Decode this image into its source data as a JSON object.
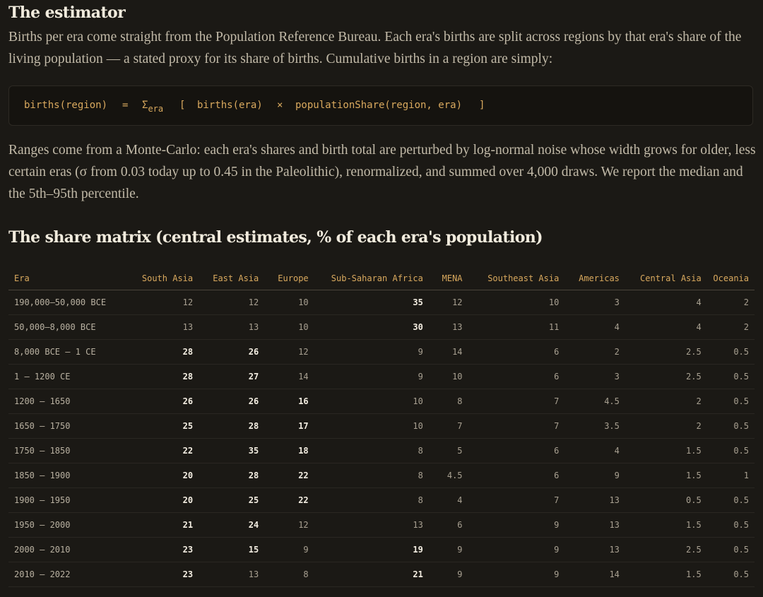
{
  "estimator": {
    "heading": "The estimator",
    "intro": "Births per era come straight from the Population Reference Bureau. Each era's births are split across regions by that era's share of the living population — a stated proxy for its share of births. Cumulative births in a region are simply:",
    "formula": {
      "lhs": "births(region)",
      "eq": "=",
      "sigma": "Σ",
      "sigma_sub": "era",
      "open": "[",
      "term1": "births(era)",
      "times": "×",
      "term2": "populationShare(region, era)",
      "close": "]"
    },
    "ranges": "Ranges come from a Monte-Carlo: each era's shares and birth total are perturbed by log-normal noise whose width grows for older, less certain eras (σ from 0.03 today up to 0.45 in the Paleolithic), renormalized, and summed over 4,000 draws. We report the median and the 5th–95th percentile."
  },
  "share_matrix": {
    "heading": "The share matrix (central estimates, % of each era's population)",
    "columns": [
      "Era",
      "South Asia",
      "East Asia",
      "Europe",
      "Sub-Saharan Africa",
      "MENA",
      "Southeast Asia",
      "Americas",
      "Central Asia",
      "Oceania"
    ],
    "rows": [
      {
        "era": "190,000–50,000 BCE",
        "values": [
          "12",
          "12",
          "10",
          "35",
          "12",
          "10",
          "3",
          "4",
          "2"
        ],
        "highlight": [
          false,
          false,
          false,
          true,
          false,
          false,
          false,
          false,
          false
        ]
      },
      {
        "era": "50,000–8,000 BCE",
        "values": [
          "13",
          "13",
          "10",
          "30",
          "13",
          "11",
          "4",
          "4",
          "2"
        ],
        "highlight": [
          false,
          false,
          false,
          true,
          false,
          false,
          false,
          false,
          false
        ]
      },
      {
        "era": "8,000 BCE – 1 CE",
        "values": [
          "28",
          "26",
          "12",
          "9",
          "14",
          "6",
          "2",
          "2.5",
          "0.5"
        ],
        "highlight": [
          true,
          true,
          false,
          false,
          false,
          false,
          false,
          false,
          false
        ]
      },
      {
        "era": "1 – 1200 CE",
        "values": [
          "28",
          "27",
          "14",
          "9",
          "10",
          "6",
          "3",
          "2.5",
          "0.5"
        ],
        "highlight": [
          true,
          true,
          false,
          false,
          false,
          false,
          false,
          false,
          false
        ]
      },
      {
        "era": "1200 – 1650",
        "values": [
          "26",
          "26",
          "16",
          "10",
          "8",
          "7",
          "4.5",
          "2",
          "0.5"
        ],
        "highlight": [
          true,
          true,
          true,
          false,
          false,
          false,
          false,
          false,
          false
        ]
      },
      {
        "era": "1650 – 1750",
        "values": [
          "25",
          "28",
          "17",
          "10",
          "7",
          "7",
          "3.5",
          "2",
          "0.5"
        ],
        "highlight": [
          true,
          true,
          true,
          false,
          false,
          false,
          false,
          false,
          false
        ]
      },
      {
        "era": "1750 – 1850",
        "values": [
          "22",
          "35",
          "18",
          "8",
          "5",
          "6",
          "4",
          "1.5",
          "0.5"
        ],
        "highlight": [
          true,
          true,
          true,
          false,
          false,
          false,
          false,
          false,
          false
        ]
      },
      {
        "era": "1850 – 1900",
        "values": [
          "20",
          "28",
          "22",
          "8",
          "4.5",
          "6",
          "9",
          "1.5",
          "1"
        ],
        "highlight": [
          true,
          true,
          true,
          false,
          false,
          false,
          false,
          false,
          false
        ]
      },
      {
        "era": "1900 – 1950",
        "values": [
          "20",
          "25",
          "22",
          "8",
          "4",
          "7",
          "13",
          "0.5",
          "0.5"
        ],
        "highlight": [
          true,
          true,
          true,
          false,
          false,
          false,
          false,
          false,
          false
        ]
      },
      {
        "era": "1950 – 2000",
        "values": [
          "21",
          "24",
          "12",
          "13",
          "6",
          "9",
          "13",
          "1.5",
          "0.5"
        ],
        "highlight": [
          true,
          true,
          false,
          false,
          false,
          false,
          false,
          false,
          false
        ]
      },
      {
        "era": "2000 – 2010",
        "values": [
          "23",
          "15",
          "9",
          "19",
          "9",
          "9",
          "13",
          "2.5",
          "0.5"
        ],
        "highlight": [
          true,
          true,
          false,
          true,
          false,
          false,
          false,
          false,
          false
        ]
      },
      {
        "era": "2010 – 2022",
        "values": [
          "23",
          "13",
          "8",
          "21",
          "9",
          "9",
          "14",
          "1.5",
          "0.5"
        ],
        "highlight": [
          true,
          false,
          false,
          true,
          false,
          false,
          false,
          false,
          false
        ]
      }
    ]
  }
}
